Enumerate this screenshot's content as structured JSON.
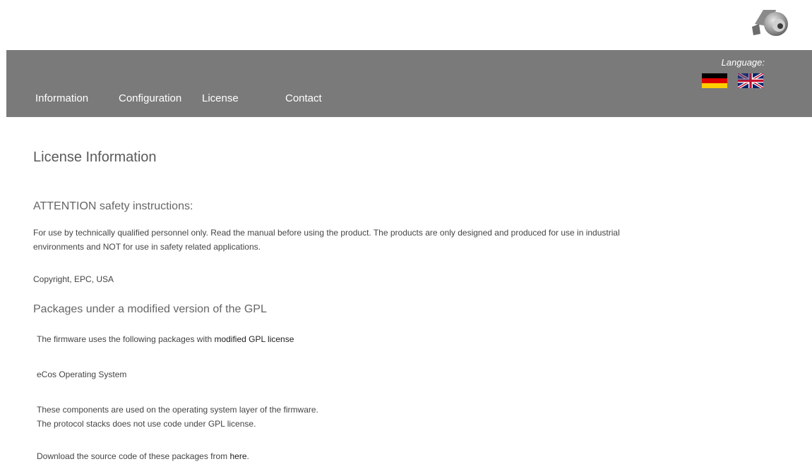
{
  "header": {
    "logo_icon": "encoder-device-icon",
    "language_label": "Language:",
    "flags": [
      {
        "name": "german-flag-icon"
      },
      {
        "name": "uk-flag-icon"
      }
    ]
  },
  "nav": {
    "items": [
      {
        "label": "Information"
      },
      {
        "label": "Configuration"
      },
      {
        "label": "License"
      },
      {
        "label": "Contact"
      }
    ]
  },
  "main": {
    "title": "License Information",
    "safety_title": "ATTENTION safety instructions:",
    "safety_text_1": "For use by technically qualified personnel only. Read the manual before using the product. The products are only designed and produced for use in industrial",
    "safety_text_2": "environments and NOT for use in safety related applications.",
    "copyright": "Copyright, EPC, USA",
    "packages_title": "Packages under a modified version of the GPL",
    "packages_intro": "The firmware uses the following packages with ",
    "packages_link": "modified GPL license",
    "package_name": "eCos Operating System",
    "components_line_1": "These components are used on the operating system layer of the firmware.",
    "components_line_2": "The protocol stacks does not use code under GPL license.",
    "download_text": "Download the source code of these packages from ",
    "download_link": "here",
    "download_suffix": "."
  },
  "colors": {
    "navbar_bg": "#7a7a7a",
    "nav_text": "#ffffff",
    "body_text": "#444444"
  }
}
